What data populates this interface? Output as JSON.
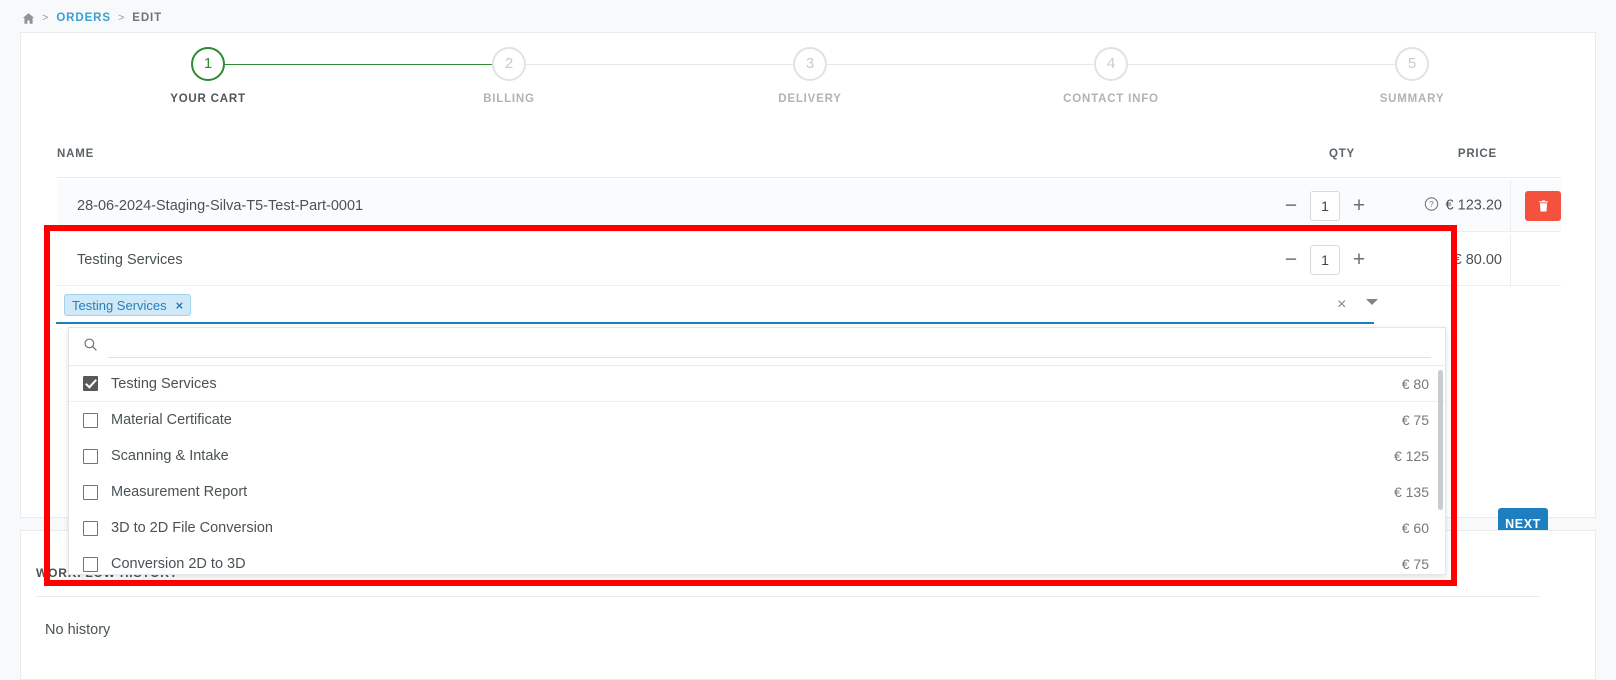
{
  "breadcrumb": {
    "home_icon": "home-icon",
    "separator": ">",
    "orders": "ORDERS",
    "current": "EDIT"
  },
  "stepper": {
    "active_color": "#2e8b32",
    "steps": [
      {
        "number": "1",
        "label": "YOUR CART",
        "active": true
      },
      {
        "number": "2",
        "label": "BILLING",
        "active": false
      },
      {
        "number": "3",
        "label": "DELIVERY",
        "active": false
      },
      {
        "number": "4",
        "label": "CONTACT INFO",
        "active": false
      },
      {
        "number": "5",
        "label": "SUMMARY",
        "active": false
      }
    ]
  },
  "table": {
    "headers": {
      "name": "NAME",
      "qty": "QTY",
      "price": "PRICE"
    },
    "rows": [
      {
        "name": "28-06-2024-Staging-Silva-T5-Test-Part-0001",
        "minus": "−",
        "qty": "1",
        "plus": "+",
        "info_icon": "question-circle-icon",
        "price": "€ 123.20",
        "delete_icon": "trash-icon"
      },
      {
        "name": "Testing Services",
        "minus": "−",
        "qty": "1",
        "plus": "+",
        "price": "€ 80.00"
      }
    ]
  },
  "multiselect": {
    "chip_label": "Testing Services",
    "chip_remove": "×",
    "clear_icon": "×",
    "caret_icon": "chevron-down-icon",
    "search_placeholder": "",
    "search_value": "",
    "search_icon": "search-icon",
    "options": [
      {
        "label": "Testing Services",
        "price": "€ 80",
        "checked": true
      },
      {
        "label": "Material Certificate",
        "price": "€ 75",
        "checked": false
      },
      {
        "label": "Scanning & Intake",
        "price": "€ 125",
        "checked": false
      },
      {
        "label": "Measurement Report",
        "price": "€ 135",
        "checked": false
      },
      {
        "label": "3D to 2D File Conversion",
        "price": "€ 60",
        "checked": false
      },
      {
        "label": "Conversion 2D to 3D",
        "price": "€ 75",
        "checked": false
      }
    ]
  },
  "actions": {
    "next_label": "NEXT",
    "next_color": "#1e7fc0"
  },
  "workflow": {
    "title": "WORKFLOW HISTORY",
    "empty_text": "No history"
  },
  "highlight": {
    "color": "#ff0000"
  }
}
